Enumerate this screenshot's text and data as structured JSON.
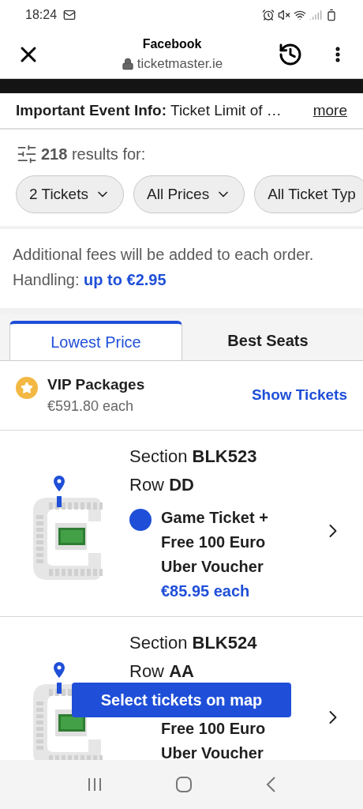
{
  "status_bar": {
    "time": "18:24"
  },
  "browser": {
    "title": "Facebook",
    "url": "ticketmaster.ie"
  },
  "notice": {
    "label": "Important Event Info:",
    "text": "Ticket Limit of …",
    "link": "more"
  },
  "results": {
    "count": "218",
    "text": "results for:"
  },
  "filters": [
    {
      "label": "2 Tickets",
      "dropdown": true
    },
    {
      "label": "All Prices",
      "dropdown": true
    },
    {
      "label": "All Ticket Typ",
      "dropdown": false
    }
  ],
  "fees": {
    "text": "Additional fees will be added to each order. Handling:",
    "amount": "up to €2.95"
  },
  "tabs": [
    {
      "label": "Lowest Price",
      "selected": true
    },
    {
      "label": "Best Seats",
      "selected": false
    }
  ],
  "vip": {
    "title": "VIP Packages",
    "price": "€591.80 each",
    "action": "Show Tickets"
  },
  "listings": [
    {
      "section_label": "Section",
      "section": "BLK523",
      "row_label": "Row",
      "row": "DD",
      "color": "#1f4fd8",
      "description": "Game Ticket + Free 100 Euro Uber Voucher",
      "price": "€85.95 each"
    },
    {
      "section_label": "Section",
      "section": "BLK524",
      "row_label": "Row",
      "row": "AA",
      "description": "Free 100 Euro Uber Voucher"
    }
  ],
  "map_button": "Select tickets on map"
}
